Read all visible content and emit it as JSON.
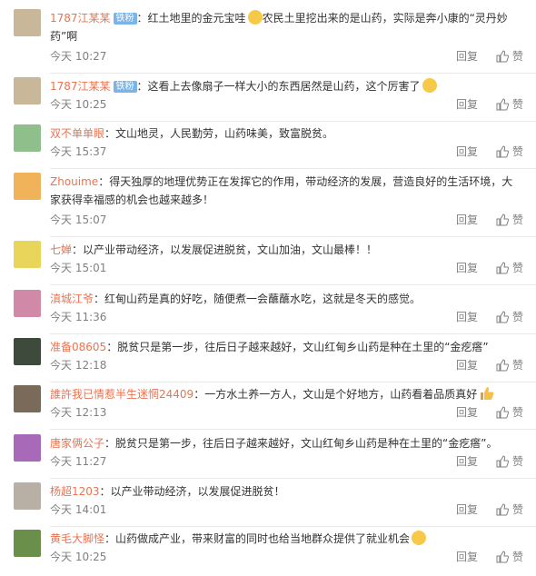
{
  "action_labels": {
    "reply": "回复",
    "like": "赞"
  },
  "comments": [
    {
      "user": "1787江某某",
      "badge": "铁粉",
      "text_before": "：红土地里的金元宝哇",
      "text_after": "农民土里挖出来的是山药，实际是奔小康的“灵丹妙药”啊",
      "time": "今天 10:27",
      "avatar_color": "#c9b79a",
      "emoji": "cry-laugh-emoji"
    },
    {
      "user": "1787江某某",
      "badge": "铁粉",
      "text_before": "：这看上去像扇子一样大小的东西居然是山药，这个厉害了",
      "text_after": "",
      "time": "今天 10:25",
      "avatar_color": "#c9b79a",
      "emoji": "thinking-emoji"
    },
    {
      "user": "双不单单眼",
      "badge": "",
      "text_before": "：文山地灵，人民勤劳，山药味美，致富脱贫。",
      "text_after": "",
      "time": "今天 15:37",
      "avatar_color": "#8fbf8a",
      "emoji": ""
    },
    {
      "user": "Zhouime",
      "badge": "",
      "text_before": "：得天独厚的地理优势正在发挥它的作用，带动经济的发展，营造良好的生活环境，大家获得幸福感的机会也越来越多！",
      "text_after": "",
      "time": "今天 15:07",
      "avatar_color": "#f0b35a",
      "emoji": ""
    },
    {
      "user": "七婵",
      "badge": "",
      "text_before": "：以产业带动经济，以发展促进脱贫，文山加油，文山最棒！！",
      "text_after": "",
      "time": "今天 15:01",
      "avatar_color": "#e8d55a",
      "emoji": ""
    },
    {
      "user": "滇城江爷",
      "badge": "",
      "text_before": "：红甸山药是真的好吃，随便煮一会蘸蘸水吃，这就是冬天的感觉。",
      "text_after": "",
      "time": "今天 11:36",
      "avatar_color": "#d08aa8",
      "emoji": ""
    },
    {
      "user": "准备08605",
      "badge": "",
      "text_before": "：脱贫只是第一步，往后日子越来越好，文山红甸乡山药是种在土里的“金疙瘩”",
      "text_after": "",
      "time": "今天 12:18",
      "avatar_color": "#3d4a3c",
      "emoji": ""
    },
    {
      "user": "誰許我已情惹半生迷惘24409",
      "badge": "",
      "text_before": "：一方水土养一方人，文山是个好地方，山药看着品质真好",
      "text_after": "",
      "time": "今天 12:13",
      "avatar_color": "#7a6a5a",
      "emoji": "thumbs-up-emoji"
    },
    {
      "user": "唐家俩公子",
      "badge": "",
      "text_before": "：脱贫只是第一步，往后日子越来越好，文山红甸乡山药是种在土里的“金疙瘩”。",
      "text_after": "",
      "time": "今天 11:27",
      "avatar_color": "#a86ab8",
      "emoji": ""
    },
    {
      "user": "杨超1203",
      "badge": "",
      "text_before": "：以产业带动经济，以发展促进脱贫！",
      "text_after": "",
      "time": "今天 14:01",
      "avatar_color": "#b8b0a4",
      "emoji": ""
    },
    {
      "user": "黄毛大脚怪",
      "badge": "",
      "text_before": "：山药做成产业，带来财富的同时也给当地群众提供了就业机会",
      "text_after": "",
      "time": "今天 10:25",
      "avatar_color": "#6a8f4a",
      "emoji": "blush-emoji"
    }
  ]
}
